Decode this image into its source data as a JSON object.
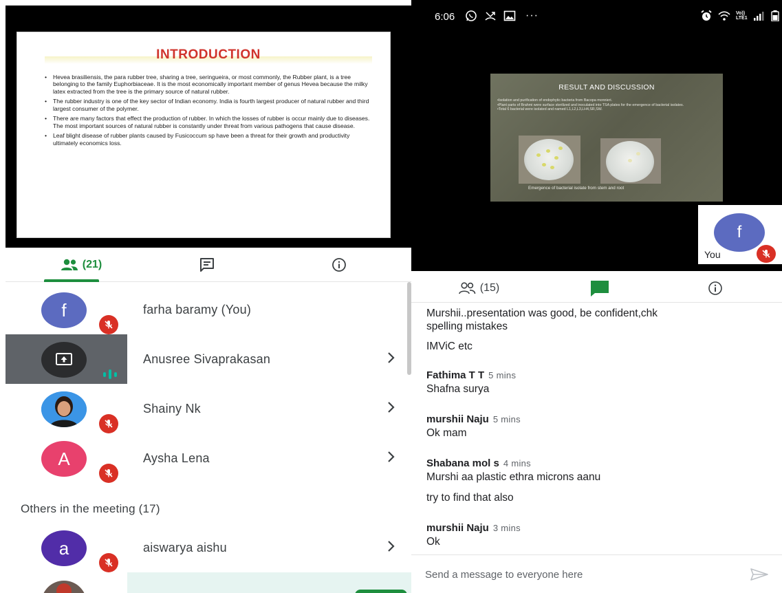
{
  "left_panel": {
    "slide": {
      "title": "INTRODUCTION",
      "bullets": [
        "Hevea brasiliensis, the para rubber tree, sharing a tree, seringueira, or most commonly, the Rubber plant, is a tree belonging to the family Euphorbiaceae. It is the most economically important member of genus Hevea because the milky latex extracted from the tree is the primary source of natural rubber.",
        "The rubber industry is one of the key sector of Indian economy. India is fourth largest producer of natural rubber and third largest consumer of the polymer.",
        "There are many factors that effect the production of rubber. In which the losses of rubber is occur mainly due to diseases. The most important sources of natural rubber is constantly under threat from various pathogens that cause disease.",
        "Leaf blight disease of rubber plants caused by Fusicoccum sp have been a threat for their growth and productivity ultimately economics loss."
      ]
    },
    "tabs": {
      "people_count": "(21)",
      "people_icon": "people-icon",
      "chat_icon": "chat-icon",
      "info_icon": "info-icon",
      "active": "people"
    },
    "participants": [
      {
        "name": "farha baramy (You)",
        "initial": "f",
        "avatar_color": "#5c6bc0",
        "muted": true,
        "chevron": false
      },
      {
        "name": "Anusree Sivaprakasan",
        "icon": "present-screen-icon",
        "presenting": true,
        "speaking": true,
        "chevron": true
      },
      {
        "name": "Shainy Nk",
        "avatar": "photo",
        "muted": true,
        "chevron": true
      },
      {
        "name": "Aysha Lena",
        "initial": "A",
        "avatar_color": "#e8416d",
        "muted": true,
        "chevron": true
      }
    ],
    "others_header": "Others in the meeting (17)",
    "others": [
      {
        "name": "aiswarya aishu",
        "initial": "a",
        "avatar_color": "#512da8",
        "muted": true,
        "chevron": true
      }
    ]
  },
  "right_panel": {
    "status_bar": {
      "time": "6:06",
      "left_icons": [
        "whatsapp-icon",
        "missed-call-icon",
        "gallery-icon",
        "more-dots-icon"
      ],
      "right_icons": [
        "alarm-icon",
        "wifi-icon",
        "volte-icon",
        "signal-icon",
        "battery-icon"
      ],
      "network_label_top": "Vo))",
      "network_label_bottom": "LTE1"
    },
    "slide": {
      "title": "RESULT AND DISCUSSION",
      "bullets": [
        "•Isolation  and purification of endophytic bacteria from Bacopa monnieri.",
        "•Plant parts of Brahmi were surface sterilized and inoculated into TSA plates for the emergence of bacterial isolates.",
        "•Total 6 bacterial were isolated and named L1,L2,L3,LH4,SR,SW."
      ],
      "caption": "Emergence of bacterial isolate from stem and root"
    },
    "self_tile": {
      "initial": "f",
      "label": "You",
      "avatar_color": "#5c6bc0",
      "muted": true
    },
    "tabs": {
      "people_count": "(15)",
      "people_icon": "people-icon",
      "chat_icon": "chat-icon",
      "info_icon": "info-icon",
      "active": "chat"
    },
    "chat": [
      {
        "sender": "",
        "time": "",
        "lines": [
          "Murshii..presentation was good, be confident,chk",
          "spelling mistakes"
        ]
      },
      {
        "sender": "",
        "time": "",
        "lines": [
          "IMViC  etc"
        ]
      },
      {
        "sender": "Fathima T T",
        "time": "5 mins",
        "lines": [
          "Shafna surya"
        ]
      },
      {
        "sender": "murshii Naju",
        "time": "5 mins",
        "lines": [
          "Ok mam"
        ]
      },
      {
        "sender": "Shabana mol s",
        "time": "4 mins",
        "lines": [
          "Murshi aa plastic ethra microns aanu"
        ]
      },
      {
        "sender": "",
        "time": "",
        "lines": [
          "try to find that also"
        ]
      },
      {
        "sender": "murshii Naju",
        "time": "3 mins",
        "lines": [
          "Ok"
        ]
      }
    ],
    "input": {
      "placeholder": "Send a message to everyone here",
      "value": "",
      "send_icon": "send-icon"
    }
  },
  "colors": {
    "accent_green": "#1e8e3e",
    "mute_red": "#d93025",
    "speaking_teal": "#00bfa5"
  }
}
